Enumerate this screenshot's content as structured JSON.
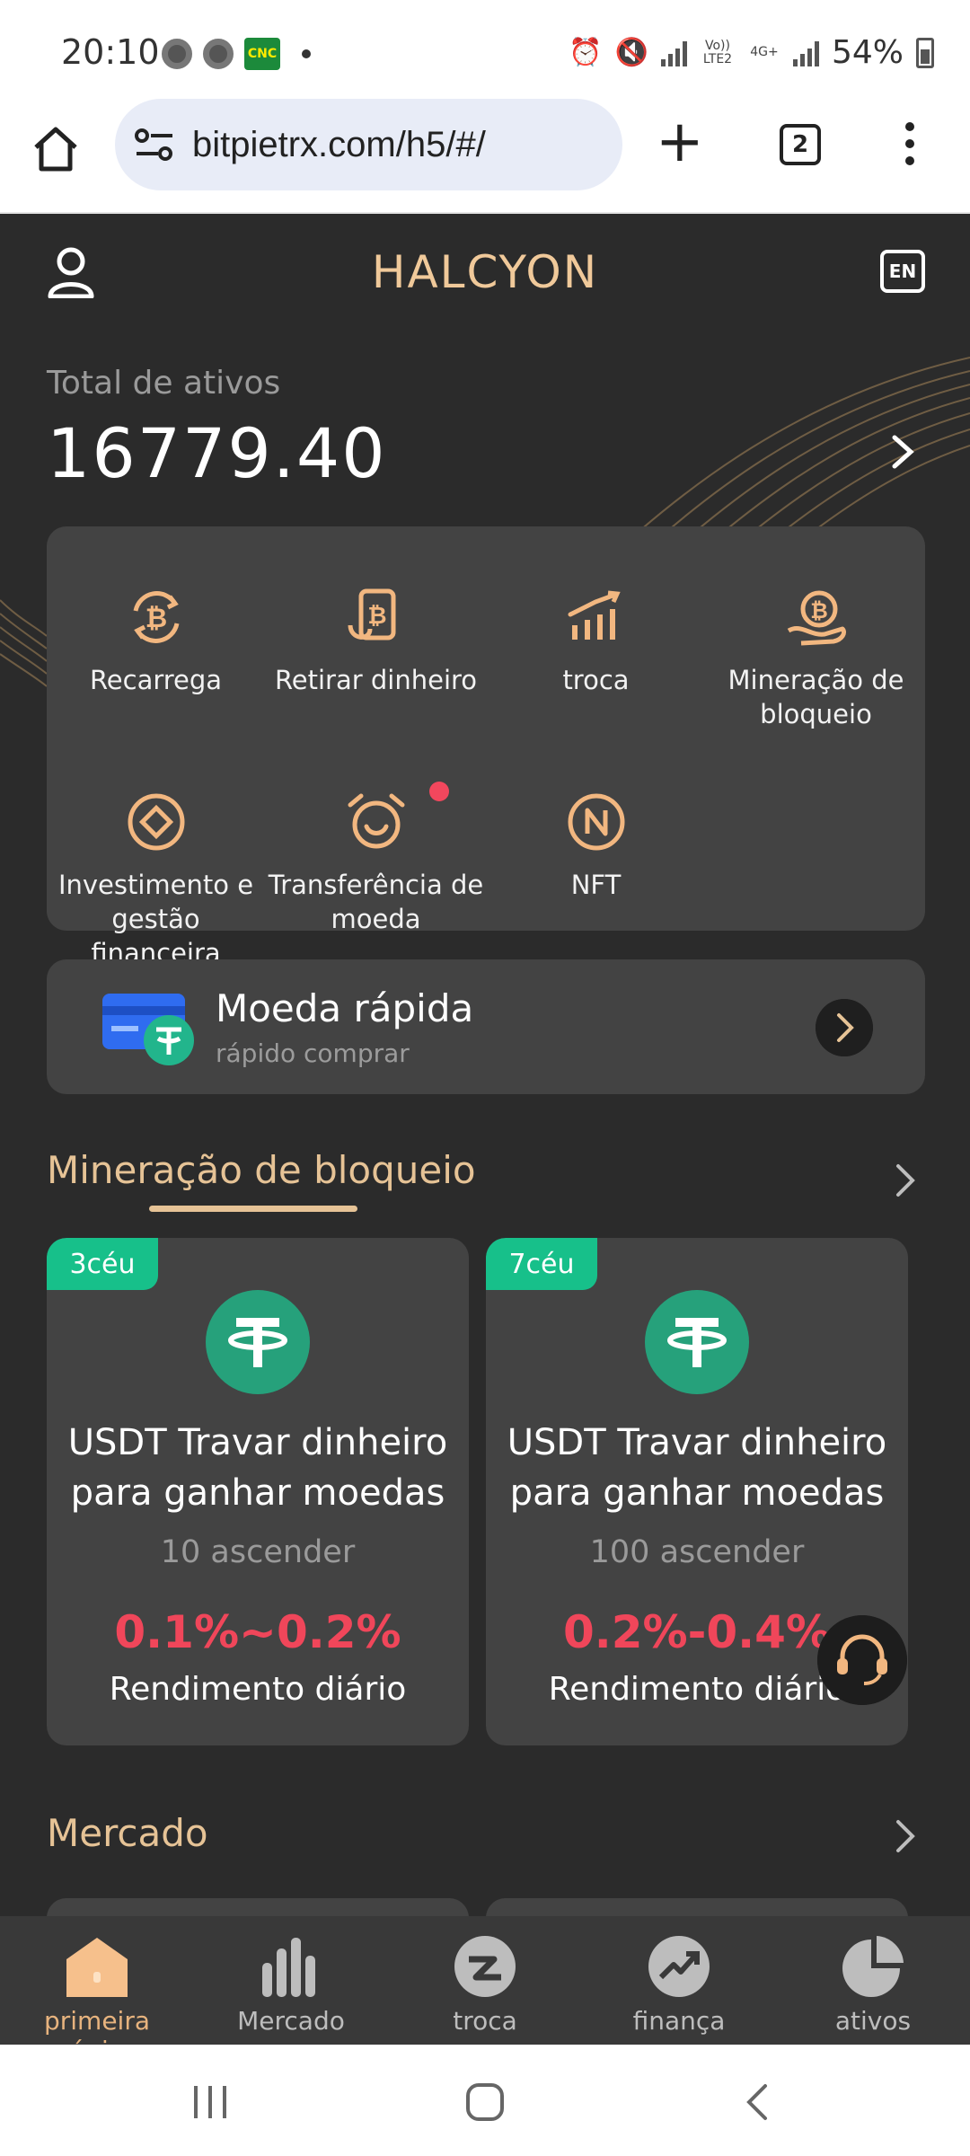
{
  "status_bar": {
    "time": "20:10",
    "cnc_badge": "CNC",
    "net_label_1": "Vo)) LTE2",
    "net_label_2": "4G+",
    "battery": "54%"
  },
  "browser": {
    "url": "bitpietrx.com/h5/#/",
    "tab_count": "2"
  },
  "app": {
    "title": "HALCYON",
    "lang_label": "EN",
    "assets_label": "Total de ativos",
    "assets_value": "16779.40",
    "quick_actions": [
      {
        "label": "Recarrega",
        "icon": "btc-refresh-icon"
      },
      {
        "label": "Retirar dinheiro",
        "icon": "btc-wallet-icon"
      },
      {
        "label": "troca",
        "icon": "chart-bars-icon"
      },
      {
        "label": "Mineração de bloqueio",
        "icon": "btc-hand-icon"
      },
      {
        "label": "Investimento e gestão financeira",
        "icon": "target-icon"
      },
      {
        "label": "Transferência de moeda",
        "icon": "alarm-clock-icon"
      },
      {
        "label": "NFT",
        "icon": "nft-icon"
      }
    ],
    "fast_coin": {
      "title": "Moeda rápida",
      "subtitle": "rápido comprar"
    },
    "mining_section_title": "Mineração de bloqueio",
    "mining_products": [
      {
        "tag": "3céu",
        "title": "USDT Travar dinheiro para ganhar moedas",
        "min_amount": "10 ascender",
        "rate": "0.1%~0.2%",
        "rate_label": "Rendimento diário"
      },
      {
        "tag": "7céu",
        "title": "USDT Travar dinheiro para ganhar moedas",
        "min_amount": "100 ascender",
        "rate": "0.2%-0.4%",
        "rate_label": "Rendimento diário"
      }
    ],
    "market_section_title": "Mercado"
  },
  "bottom_nav": [
    {
      "label": "primeira página",
      "icon": "home-icon",
      "active": true
    },
    {
      "label": "Mercado",
      "icon": "bar-chart-icon",
      "active": false
    },
    {
      "label": "troca",
      "icon": "exchange-icon",
      "active": false
    },
    {
      "label": "finança",
      "icon": "trend-up-icon",
      "active": false
    },
    {
      "label": "ativos",
      "icon": "pie-chart-icon",
      "active": false
    }
  ],
  "colors": {
    "accent_gold": "#e6c396",
    "rate_red": "#f0465a",
    "tag_green": "#17c08a",
    "tether_green": "#26a17b"
  }
}
